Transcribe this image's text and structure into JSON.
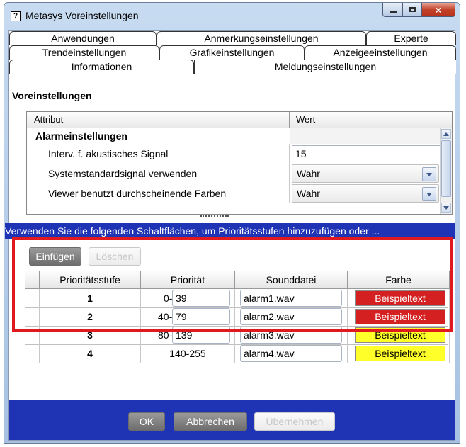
{
  "window": {
    "title": "Metasys Voreinstellungen",
    "close_glyph": "×"
  },
  "tabs": {
    "row1": [
      "Anwendungen",
      "Anmerkungseinstellungen",
      "Experte"
    ],
    "row2": [
      "Trendeinstellungen",
      "Grafikeinstellungen",
      "Anzeigeeinstellungen"
    ],
    "row3": [
      "Informationen",
      "Meldungseinstellungen"
    ],
    "active": "Meldungseinstellungen"
  },
  "section_title": "Voreinstellungen",
  "attributes": {
    "headers": [
      "Attribut",
      "Wert"
    ],
    "group": "Alarmeinstellungen",
    "rows": [
      {
        "label": "Interv. f. akustisches Signal",
        "value": "15",
        "type": "input"
      },
      {
        "label": "Systemstandardsignal verwenden",
        "value": "Wahr",
        "type": "combo"
      },
      {
        "label": "Viewer benutzt durchscheinende Farben",
        "value": "Wahr",
        "type": "combo"
      }
    ]
  },
  "info_text": "Verwenden Sie die folgenden Schaltflächen, um Prioritätsstufen hinzuzufügen oder ...",
  "actions": {
    "insert": "Einfügen",
    "delete": "Löschen"
  },
  "priority_table": {
    "headers": [
      "Prioritätsstufe",
      "Priorität",
      "Sounddatei",
      "Farbe"
    ],
    "rows": [
      {
        "level": "1",
        "prefix": "0-",
        "upper": "39",
        "sound": "alarm1.wav",
        "color_label": "Beispieltext",
        "color": "#d42020",
        "text_color": "#ffffff"
      },
      {
        "level": "2",
        "prefix": "40-",
        "upper": "79",
        "sound": "alarm2.wav",
        "color_label": "Beispieltext",
        "color": "#d42020",
        "text_color": "#ffffff"
      },
      {
        "level": "3",
        "prefix": "80-",
        "upper": "139",
        "sound": "alarm3.wav",
        "color_label": "Beispieltext",
        "color": "#ffff2a",
        "text_color": "#000000"
      },
      {
        "level": "4",
        "range": "140-255",
        "sound": "alarm4.wav",
        "color_label": "Beispieltext",
        "color": "#ffff2a",
        "text_color": "#000000"
      }
    ]
  },
  "footer": {
    "ok": "OK",
    "cancel": "Abbrechen",
    "apply": "Übernehmen"
  },
  "colors": {
    "accent_blue": "#1f33b5",
    "highlight_outline": "#e0191f"
  },
  "icons": {
    "app": "app-icon",
    "minimize": "minimize-icon",
    "maximize": "maximize-icon",
    "close": "close-icon",
    "dropdown": "chevron-down-icon",
    "scroll_up": "scroll-up-icon",
    "scroll_down": "scroll-down-icon"
  }
}
